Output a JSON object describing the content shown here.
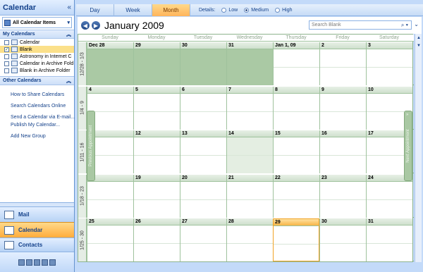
{
  "nav": {
    "title": "Calendar",
    "collapse_glyph": "«",
    "all_items": "All Calendar Items",
    "my_calendars": {
      "header": "My Calendars",
      "items": [
        {
          "label": "Calendar",
          "checked": false
        },
        {
          "label": "Blank",
          "checked": true,
          "selected": true
        },
        {
          "label": "Astronomy in Internet C",
          "checked": false
        },
        {
          "label": "Calendar in Archive Fold",
          "checked": false
        },
        {
          "label": "Blank in Archive Folder",
          "checked": false
        }
      ]
    },
    "other_calendars": {
      "header": "Other Calendars"
    },
    "links": [
      "How to Share Calendars",
      "Search Calendars Online",
      "Send a Calendar via E-mail...",
      "Publish My Calendar...",
      "Add New Group"
    ],
    "buttons": {
      "mail": "Mail",
      "calendar": "Calendar",
      "contacts": "Contacts"
    }
  },
  "toolbar": {
    "tabs": [
      {
        "label": "Day",
        "active": false
      },
      {
        "label": "Week",
        "active": false
      },
      {
        "label": "Month",
        "active": true
      }
    ],
    "details_label": "Details:",
    "details_options": [
      {
        "label": "Low",
        "selected": false
      },
      {
        "label": "Medium",
        "selected": true
      },
      {
        "label": "High",
        "selected": false
      }
    ]
  },
  "header": {
    "month_title": "January 2009",
    "search_placeholder": "Search Blank"
  },
  "calendar": {
    "weekdays": [
      "Sunday",
      "Monday",
      "Tuesday",
      "Wednesday",
      "Thursday",
      "Friday",
      "Saturday"
    ],
    "weeks": [
      {
        "label": "12/28 - 1/3",
        "days": [
          "Dec 28",
          "29",
          "30",
          "31",
          "Jan 1, 09",
          "2",
          "3"
        ],
        "shaded": [
          true,
          true,
          true,
          true,
          false,
          false,
          false
        ]
      },
      {
        "label": "1/4 - 9",
        "days": [
          "4",
          "5",
          "6",
          "7",
          "8",
          "9",
          "10"
        ],
        "shaded": [
          false,
          false,
          false,
          false,
          false,
          false,
          false
        ]
      },
      {
        "label": "1/11 - 16",
        "days": [
          "11",
          "12",
          "13",
          "14",
          "15",
          "16",
          "17"
        ],
        "light": [
          false,
          false,
          false,
          true,
          false,
          false,
          false
        ]
      },
      {
        "label": "1/18 - 23",
        "days": [
          "18",
          "19",
          "20",
          "21",
          "22",
          "23",
          "24"
        ]
      },
      {
        "label": "1/25 - 30",
        "days": [
          "25",
          "26",
          "27",
          "28",
          "29",
          "30",
          "31"
        ],
        "today_index": 4
      }
    ],
    "previous_appointment": "Previous Appointment",
    "next_appointment": "Next Appointment"
  }
}
